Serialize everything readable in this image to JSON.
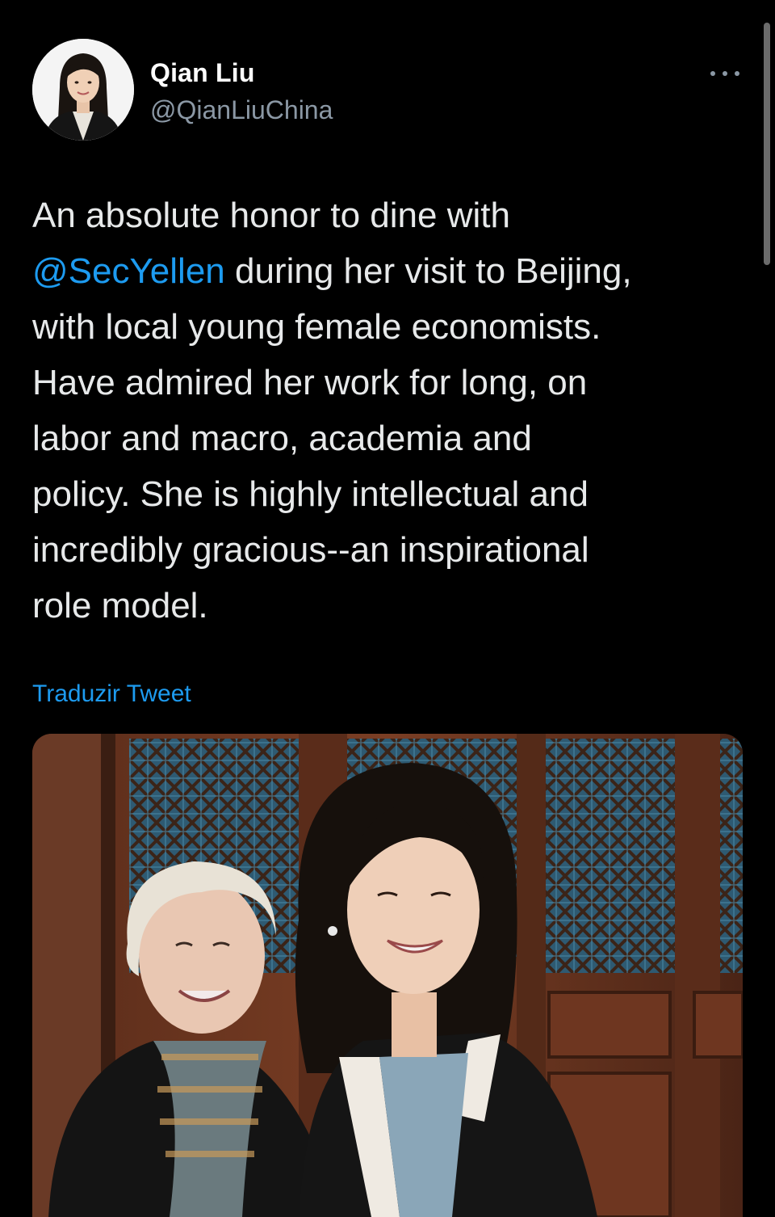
{
  "scrollbar": {},
  "author": {
    "name": "Qian Liu",
    "handle": "@QianLiuChina",
    "avatar_icon": "profile-photo"
  },
  "more_icon": "more-horizontal-icon",
  "tweet": {
    "lines": [
      {
        "text": "An absolute honor to dine with"
      },
      {
        "mention": "@SecYellen",
        "text": " during her visit to Beijing,"
      },
      {
        "text": "with local young female economists."
      },
      {
        "text": "Have admired her work for long, on"
      },
      {
        "text": "labor and macro, academia and"
      },
      {
        "text": "policy. She is highly intellectual and"
      },
      {
        "text": "incredibly gracious--an inspirational"
      },
      {
        "text": "role model."
      }
    ]
  },
  "translate_label": "Traduzir Tweet",
  "colors": {
    "background": "#000000",
    "text": "#e7e9ea",
    "secondary": "#8b98a5",
    "accent": "#1d9bf0"
  }
}
